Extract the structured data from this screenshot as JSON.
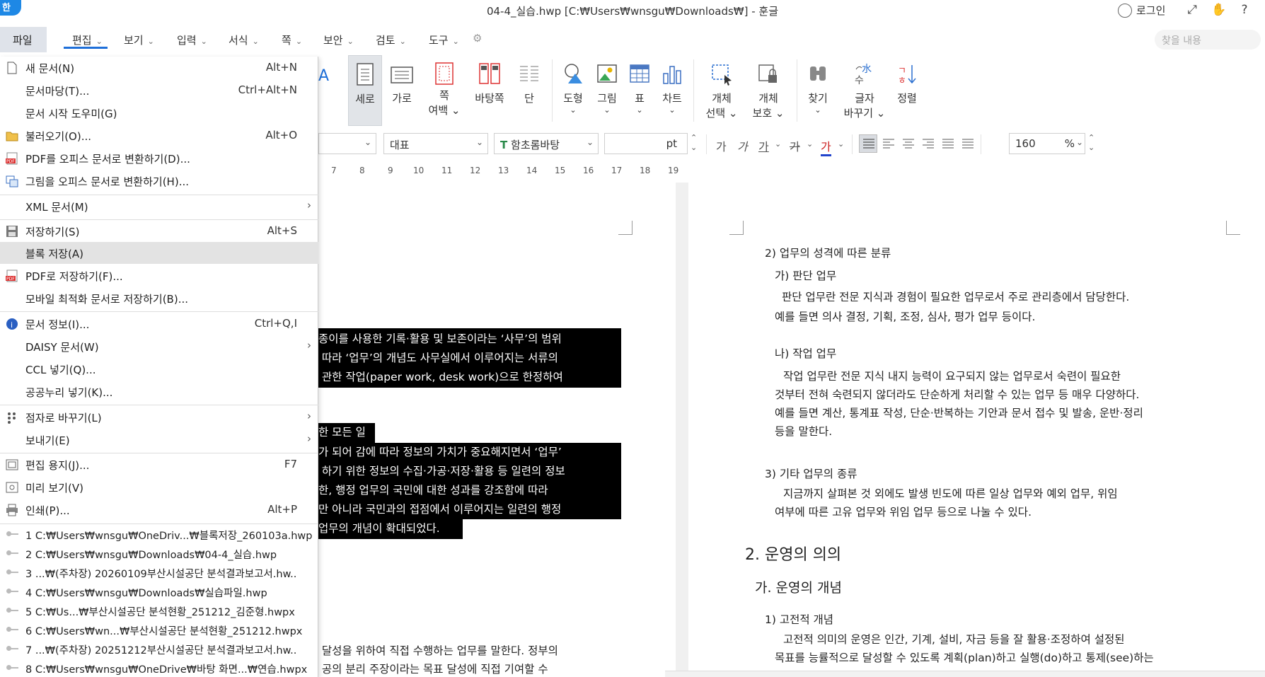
{
  "window": {
    "title": "04-4_실습.hwp [C:₩Users₩wnsgu₩Downloads₩] - 훈글",
    "logo": "한",
    "login": "로그인",
    "icons": [
      "fullscreen-icon",
      "hand-icon",
      "help-icon"
    ]
  },
  "menubar": {
    "file": "파일",
    "items": [
      "편집",
      "보기",
      "입력",
      "서식",
      "쪽",
      "보안",
      "검토",
      "도구"
    ],
    "search_placeholder": "찾을 내용"
  },
  "ribbon": {
    "partial_label": "파일",
    "buttons": [
      {
        "label": "세로",
        "icon": "portrait-icon",
        "active": true
      },
      {
        "label": "가로",
        "icon": "landscape-icon"
      },
      {
        "label": "쪽",
        "label2": "여백",
        "icon": "page-margin-icon"
      },
      {
        "label": "바탕쪽",
        "icon": "master-page-icon"
      },
      {
        "label": "단",
        "icon": "columns-icon"
      },
      {
        "label": "도형",
        "icon": "shape-icon"
      },
      {
        "label": "그림",
        "icon": "picture-icon"
      },
      {
        "label": "표",
        "icon": "table-icon"
      },
      {
        "label": "차트",
        "icon": "chart-icon"
      },
      {
        "label": "개체",
        "label2": "선택",
        "icon": "object-select-icon"
      },
      {
        "label": "개체",
        "label2": "보호",
        "icon": "object-protect-icon"
      },
      {
        "label": "찾기",
        "icon": "find-icon"
      },
      {
        "label": "글자",
        "label2": "바꾸기",
        "icon": "char-replace-icon"
      },
      {
        "label": "정렬",
        "icon": "sort-icon"
      }
    ]
  },
  "format": {
    "style": "대표",
    "font": "함초롬바탕",
    "size_unit": "pt",
    "zoom": "160",
    "zoom_unit": "%",
    "glyphs": [
      "가",
      "가",
      "가",
      "가",
      "가"
    ]
  },
  "ruler": [
    "7",
    "8",
    "9",
    "10",
    "11",
    "12",
    "13",
    "14",
    "15",
    "16",
    "17",
    "18",
    "19"
  ],
  "file_menu": {
    "items": [
      {
        "label": "새 문서(N)",
        "shortcut": "Alt+N",
        "icon": "new-doc-icon"
      },
      {
        "label": "문서마당(T)...",
        "shortcut": "Ctrl+Alt+N"
      },
      {
        "label": "문서 시작 도우미(G)",
        "shortcut": ""
      },
      {
        "label": "불러오기(O)...",
        "shortcut": "Alt+O",
        "icon": "open-folder-icon"
      },
      {
        "label": "PDF를 오피스 문서로 변환하기(D)...",
        "shortcut": "",
        "icon": "pdf-icon"
      },
      {
        "label": "그림을 오피스 문서로 변환하기(H)...",
        "shortcut": "",
        "icon": "image-convert-icon"
      },
      {
        "label": "XML 문서(M)",
        "shortcut": "",
        "submenu": true
      },
      {
        "label": "저장하기(S)",
        "shortcut": "Alt+S",
        "icon": "save-icon"
      },
      {
        "label": "블록 저장(A)",
        "shortcut": "",
        "highlight": true
      },
      {
        "label": "PDF로 저장하기(F)...",
        "shortcut": "",
        "icon": "pdf-save-icon"
      },
      {
        "label": "모바일 최적화 문서로 저장하기(B)...",
        "shortcut": ""
      },
      {
        "label": "문서 정보(I)...",
        "shortcut": "Ctrl+Q,I",
        "icon": "info-icon"
      },
      {
        "label": "DAISY 문서(W)",
        "shortcut": "",
        "submenu": true
      },
      {
        "label": "CCL 넣기(Q)...",
        "shortcut": ""
      },
      {
        "label": "공공누리 넣기(K)...",
        "shortcut": ""
      },
      {
        "label": "점자로 바꾸기(L)",
        "shortcut": "",
        "submenu": true,
        "icon": "braille-icon"
      },
      {
        "label": "보내기(E)",
        "shortcut": "",
        "submenu": true
      },
      {
        "label": "편집 용지(J)...",
        "shortcut": "F7",
        "icon": "page-setup-icon"
      },
      {
        "label": "미리 보기(V)",
        "shortcut": "",
        "icon": "preview-icon"
      },
      {
        "label": "인쇄(P)...",
        "shortcut": "Alt+P",
        "icon": "print-icon"
      }
    ],
    "recent": [
      "1 C:₩Users₩wnsgu₩OneDriv...₩블록저장_260103a.hwp",
      "2 C:₩Users₩wnsgu₩Downloads₩04-4_실습.hwp",
      "3 ...₩(주차장) 20260109부산시설공단 분석결과보고서.hw..",
      "4 C:₩Users₩wnsgu₩Downloads₩실습파일.hwp",
      "5 C:₩Us...₩부산시설공단 분석현황_251212_김준형.hwpx",
      "6 C:₩Users₩wn...₩부산시설공단 분석현황_251212.hwpx",
      "7 ...₩(주차장) 20251212부산시설공단 분석결과보고서.hw..",
      "8 C:₩Users₩wnsgu₩OneDrive₩바탕 화면...₩연습.hwpx"
    ]
  },
  "doc_left": {
    "block1": [
      "종이를 사용한 기록·활용 및 보존이라는 ‘사무’의 범위",
      " 따라 ‘업무’의 개념도 사무실에서 이루어지는 서류의",
      " 관한 작업(paper work, desk work)으로 한정하여"
    ],
    "block2a": "한 모든 일",
    "block2": [
      "가 되어 감에 따라 정보의 가치가 중요해지면서 ‘업무’",
      " 하기 위한 정보의 수집·가공·저장·활용 등 일련의 정보",
      "한, 행정 업무의 국민에 대한 성과를 강조함에 따라",
      "만 아니라 국민과의 접점에서 이루어지는 일련의 행정",
      "업무의 개념이 확대되었다."
    ],
    "tail1": " 달성을 위하여 직접 수행하는 업무를 말한다. 정부의",
    "tail2": " 공의 분리 주장이라는 목표 달성에 직접 기여할 수"
  },
  "doc_right": {
    "l1": "2) 업무의 성격에 따른 분류",
    "l2": "가) 판단 업무",
    "l3": "판단 업무란 전문 지식과 경험이 필요한 업무로서 주로 관리층에서 담당한다.",
    "l4": "예를 들면 의사 결정, 기획, 조정, 심사, 평가 업무 등이다.",
    "l5": "나) 작업 업무",
    "l6": "작업 업무란 전문 지식 내지 능력이 요구되지 않는 업무로서 숙련이 필요한",
    "l7": "것부터 전혀 숙련되지 않더라도 단순하게 처리할 수 있는 업무 등 매우 다양하다.",
    "l8": "예를 들면 계산, 통계표 작성, 단순·반복하는 기안과 문서 접수 및 발송, 운반·정리",
    "l9": "등을 말한다.",
    "l10": "3) 기타 업무의 종류",
    "l11": "지금까지 살펴본 것 외에도 발생 빈도에 따른 일상 업무와 예외 업무, 위임",
    "l12": "여부에 따른 고유 업무와 위임 업무 등으로 나눌 수 있다.",
    "h1": "2. 운영의 의의",
    "h2": "가. 운영의 개념",
    "l13": "1) 고전적 개념",
    "l14": "고전적 의미의 운영은 인간, 기계, 설비, 자금 등을 잘 활용·조정하여 설정된",
    "l15": "목표를 능률적으로 달성할 수 있도록 계획(plan)하고 실행(do)하고 통제(see)하는"
  }
}
